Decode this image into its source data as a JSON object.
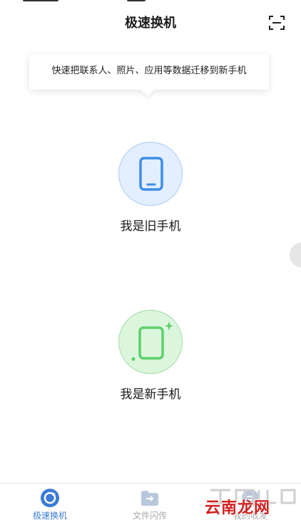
{
  "header": {
    "title": "极速换机"
  },
  "tip": {
    "text": "快速把联系人、照片、应用等数据迁移到新手机"
  },
  "options": {
    "old_phone": {
      "label": "我是旧手机"
    },
    "new_phone": {
      "label": "我是新手机"
    }
  },
  "tabbar": {
    "tabs": [
      {
        "label": "极速换机",
        "active": true
      },
      {
        "label": "文件闪传",
        "active": false
      },
      {
        "label": "我的收发",
        "active": false
      }
    ]
  },
  "watermark": {
    "text": "云南龙网"
  },
  "colors": {
    "accent": "#3a7bd5",
    "old_phone_bg": "#e3efff",
    "new_phone_bg": "#dcf6de",
    "new_phone_icon": "#5ccf6a"
  }
}
